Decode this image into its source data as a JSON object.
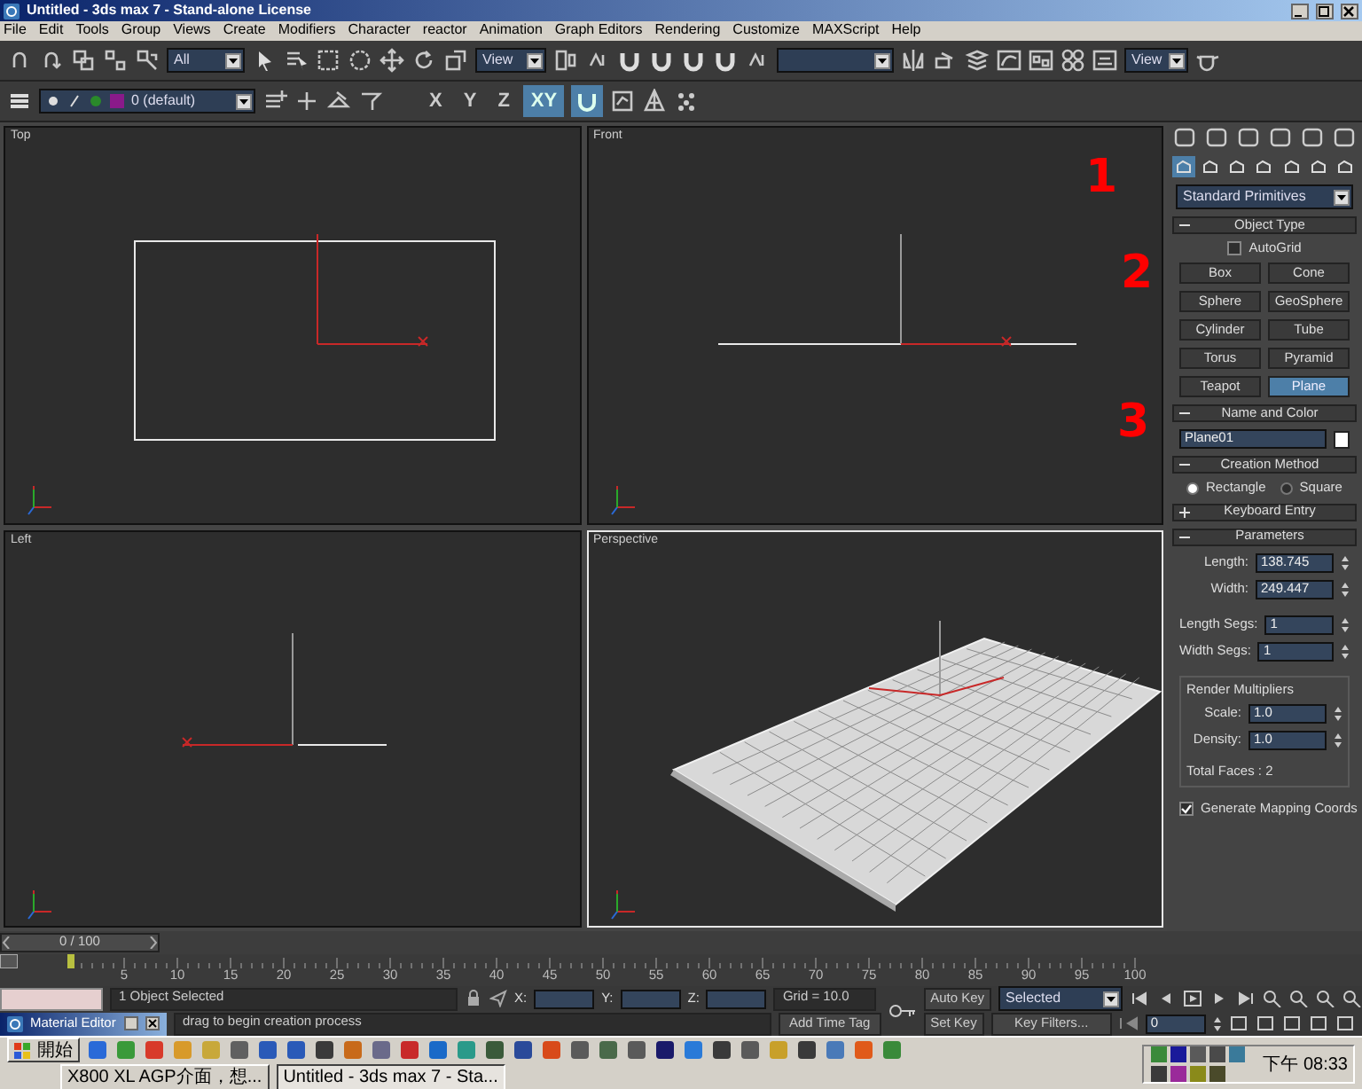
{
  "window": {
    "title": "Untitled - 3ds max 7 - Stand-alone License"
  },
  "menu": [
    "File",
    "Edit",
    "Tools",
    "Group",
    "Views",
    "Create",
    "Modifiers",
    "Character",
    "reactor",
    "Animation",
    "Graph Editors",
    "Rendering",
    "Customize",
    "MAXScript",
    "Help"
  ],
  "main_toolbar": {
    "selection_filter": "All",
    "reference_coordinate": "View",
    "render_type": "View"
  },
  "layer_toolbar": {
    "layer": "0 (default)",
    "axis_buttons": [
      {
        "label": "X",
        "selected": false
      },
      {
        "label": "Y",
        "selected": false
      },
      {
        "label": "Z",
        "selected": false
      },
      {
        "label": "XY",
        "selected": true
      }
    ]
  },
  "viewports": [
    {
      "label": "Top",
      "kind": "top",
      "active": false
    },
    {
      "label": "Front",
      "kind": "front",
      "active": false
    },
    {
      "label": "Left",
      "kind": "left",
      "active": false
    },
    {
      "label": "Perspective",
      "kind": "perspective",
      "active": true
    }
  ],
  "command_panel": {
    "categories": [
      {
        "selected": true
      },
      {
        "selected": false
      },
      {
        "selected": false
      },
      {
        "selected": false
      },
      {
        "selected": false
      },
      {
        "selected": false
      },
      {
        "selected": false
      }
    ],
    "object_class": "Standard Primitives",
    "rollouts": [
      {
        "kind": "object_type",
        "title": "Object Type",
        "expanded": true,
        "autogrid": {
          "label": "AutoGrid",
          "checked": false
        },
        "buttons": [
          {
            "label": "Box",
            "selected": false
          },
          {
            "label": "Cone",
            "selected": false
          },
          {
            "label": "Sphere",
            "selected": false
          },
          {
            "label": "GeoSphere",
            "selected": false
          },
          {
            "label": "Cylinder",
            "selected": false
          },
          {
            "label": "Tube",
            "selected": false
          },
          {
            "label": "Torus",
            "selected": false
          },
          {
            "label": "Pyramid",
            "selected": false
          },
          {
            "label": "Teapot",
            "selected": false
          },
          {
            "label": "Plane",
            "selected": true
          }
        ]
      },
      {
        "kind": "name_color",
        "title": "Name and Color",
        "expanded": true,
        "name": "Plane01",
        "color": "#ffffff"
      },
      {
        "kind": "creation_method",
        "title": "Creation Method",
        "expanded": true,
        "options": [
          {
            "label": "Rectangle",
            "selected": true
          },
          {
            "label": "Square",
            "selected": false
          }
        ]
      },
      {
        "kind": "keyboard_entry",
        "title": "Keyboard Entry",
        "expanded": false
      },
      {
        "kind": "parameters",
        "title": "Parameters",
        "expanded": true,
        "fields": [
          {
            "label": "Length:",
            "value": "138.745"
          },
          {
            "label": "Width:",
            "value": "249.447"
          },
          {
            "label": "Length Segs:",
            "value": "1"
          },
          {
            "label": "Width Segs:",
            "value": "1"
          }
        ],
        "group": {
          "title": "Render Multipliers",
          "fields": [
            {
              "label": "Scale:",
              "value": "1.0"
            },
            {
              "label": "Density:",
              "value": "1.0"
            }
          ],
          "total": "Total Faces : 2"
        },
        "option": {
          "label": "Generate Mapping Coords",
          "checked": true
        }
      }
    ]
  },
  "annotations": [
    {
      "text": "1"
    },
    {
      "text": "2"
    },
    {
      "text": "3"
    }
  ],
  "time_slider": {
    "label": "0 / 100",
    "level": 0
  },
  "track_bar": {
    "ticks": [
      "5",
      "10",
      "15",
      "20",
      "25",
      "30",
      "35",
      "40",
      "45",
      "50",
      "55",
      "60",
      "65",
      "70",
      "75",
      "80",
      "85",
      "90",
      "95",
      "100"
    ]
  },
  "status_bar": {
    "selection": "1 Object Selected",
    "coordinates": [
      {
        "label": "X:"
      },
      {
        "label": "Y:"
      },
      {
        "label": "Z:"
      }
    ],
    "grid": "Grid = 10.0",
    "minimized_window": "Material Editor",
    "prompt": "drag to begin creation process",
    "add_time_tag": "Add Time Tag",
    "auto_key": "Auto Key",
    "key_mode": "Selected",
    "set_key": "Set Key",
    "key_filters": "Key Filters...",
    "frame": "0"
  },
  "taskbar": {
    "start": "開始",
    "tasks": [
      {
        "label": "X800 XL AGP介面，想...",
        "selected": false
      },
      {
        "label": "Untitled - 3ds max 7 - Sta...",
        "selected": true
      }
    ],
    "clock": "下午 08:33"
  }
}
